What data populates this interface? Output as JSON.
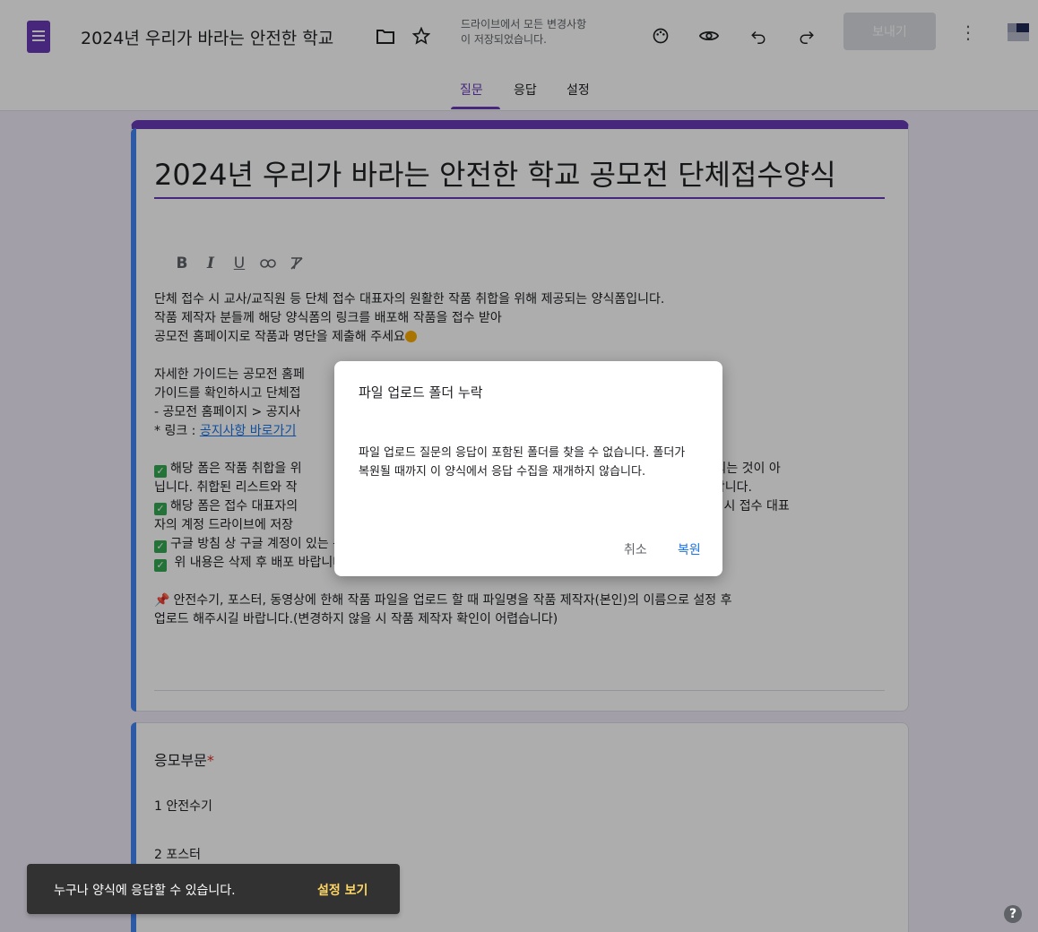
{
  "header": {
    "doc_title": "2024년 우리가 바라는 안전한 학교 ",
    "save_status_line1": "드라이브에서 모든 변경사항",
    "save_status_line2": "이 저장되었습니다.",
    "send_label": "보내기",
    "icons": [
      "forms-logo-icon",
      "folder-icon",
      "star-icon",
      "palette-icon",
      "preview-eye-icon",
      "undo-icon",
      "redo-icon",
      "more-vert-icon",
      "avatar"
    ]
  },
  "tabs": [
    {
      "label": "질문",
      "active": true
    },
    {
      "label": "응답",
      "active": false
    },
    {
      "label": "설정",
      "active": false
    }
  ],
  "form": {
    "title": "2024년 우리가 바라는 안전한 학교 공모전 단체접수양식",
    "format_buttons": [
      "B",
      "I",
      "U",
      "link",
      "clear-format"
    ],
    "description": {
      "l1": "단체 접수 시 교사/교직원 등 단체 접수 대표자의 원활한 작품 취합을 위해 제공되는 양식폼입니다.",
      "l2": "작품 제작자 분들께 해당 양식폼의 링크를 배포해 작품을 접수 받아",
      "l3": "공모전 홈페이지로 작품과 명단을 제출해 주세요",
      "l4": "자세한 가이드는 공모전 홈페",
      "l5": "가이드를 확인하시고 단체접",
      "l6": "- 공모전 홈페이지 > 공지사",
      "l7_prefix": " * 링크 : ",
      "l7_link": "공지사항 바로가기",
      "l8a": "해당 폼은 작품 취합을 위",
      "l8b": "모전에 접수되는 것이 아",
      "l9a": "닙니다. 취합된 리스트와 작",
      "l9b": "해 주셔야 합니다.",
      "l10a": "해당 폼은 접수 대표자의",
      "l10b": "등과 정보 역시 접수 대표",
      "l11": "자의 계정 드라이브에 저장",
      "l12": "구글 방침 상 구글 계정이 있는 분에 한해서만 구글폼에 작품을 제출하실 수 있습니다.",
      "l13": " 위 내용은 삭제 후 배포 바랍니다.",
      "l14": "안전수기, 포스터, 동영상에 한해 작품 파일을 업로드 할 때 파일명을 작품 제작자(본인)의 이름으로 설정 후",
      "l15": "업로드 해주시길 바랍니다.(변경하지 않을 시 작품 제작자 확인이 어렵습니다)"
    }
  },
  "question": {
    "title": "응모부문",
    "required_mark": "*",
    "options": [
      "1  안전수기",
      "2  포스터"
    ]
  },
  "dialog": {
    "title": "파일 업로드 폴더 누락",
    "body": "파일 업로드 질문의 응답이 포함된 폴더를 찾을 수 없습니다. 폴더가 복원될 때까지 이 양식에서 응답 수집을 재개하지 않습니다.",
    "cancel_label": "취소",
    "restore_label": "복원"
  },
  "snackbar": {
    "message": "누구나 양식에 응답할 수 있습니다.",
    "action_label": "설정 보기"
  },
  "colors": {
    "accent": "#673ab7",
    "link": "#1a73e8",
    "snackbar_action": "#fdd663"
  }
}
